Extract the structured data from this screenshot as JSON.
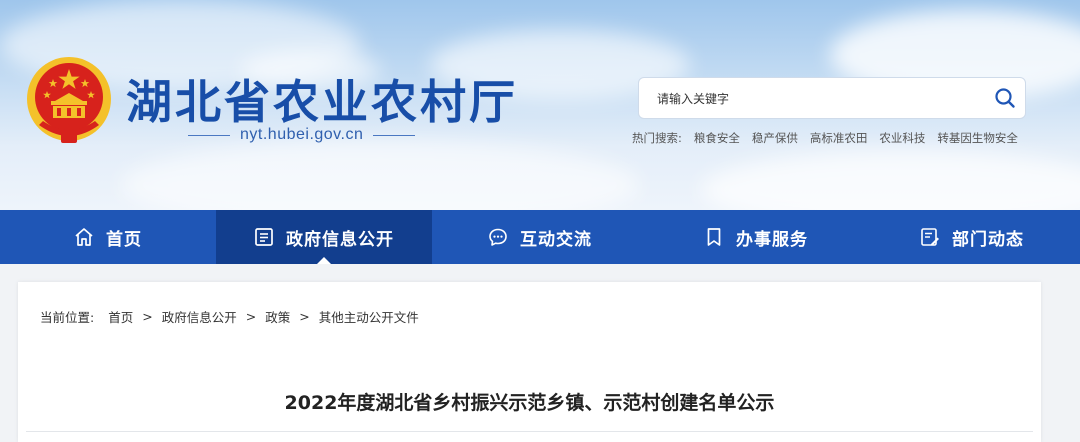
{
  "site": {
    "title": "湖北省农业农村厅",
    "domain": "nyt.hubei.gov.cn"
  },
  "search": {
    "placeholder": "请输入关键字",
    "hot_label": "热门搜索:",
    "hot_terms": [
      "粮食安全",
      "稳产保供",
      "高标准农田",
      "农业科技",
      "转基因生物安全"
    ]
  },
  "nav": {
    "items": [
      {
        "label": "首页",
        "icon": "home-icon"
      },
      {
        "label": "政府信息公开",
        "icon": "document-list-icon",
        "active": true
      },
      {
        "label": "互动交流",
        "icon": "chat-bubble-icon"
      },
      {
        "label": "办事服务",
        "icon": "bookmark-icon"
      },
      {
        "label": "部门动态",
        "icon": "news-edit-icon"
      }
    ]
  },
  "breadcrumb": {
    "label": "当前位置:",
    "items": [
      "首页",
      "政府信息公开",
      "政策",
      "其他主动公开文件"
    ],
    "separator": ">"
  },
  "article": {
    "title": "2022年度湖北省乡村振兴示范乡镇、示范村创建名单公示"
  },
  "colors": {
    "nav_bg": "#1f56b6",
    "nav_active_bg": "#123e8e",
    "title_blue": "#184ea8",
    "emblem_red": "#d7221c",
    "emblem_gold": "#f4c12a"
  }
}
